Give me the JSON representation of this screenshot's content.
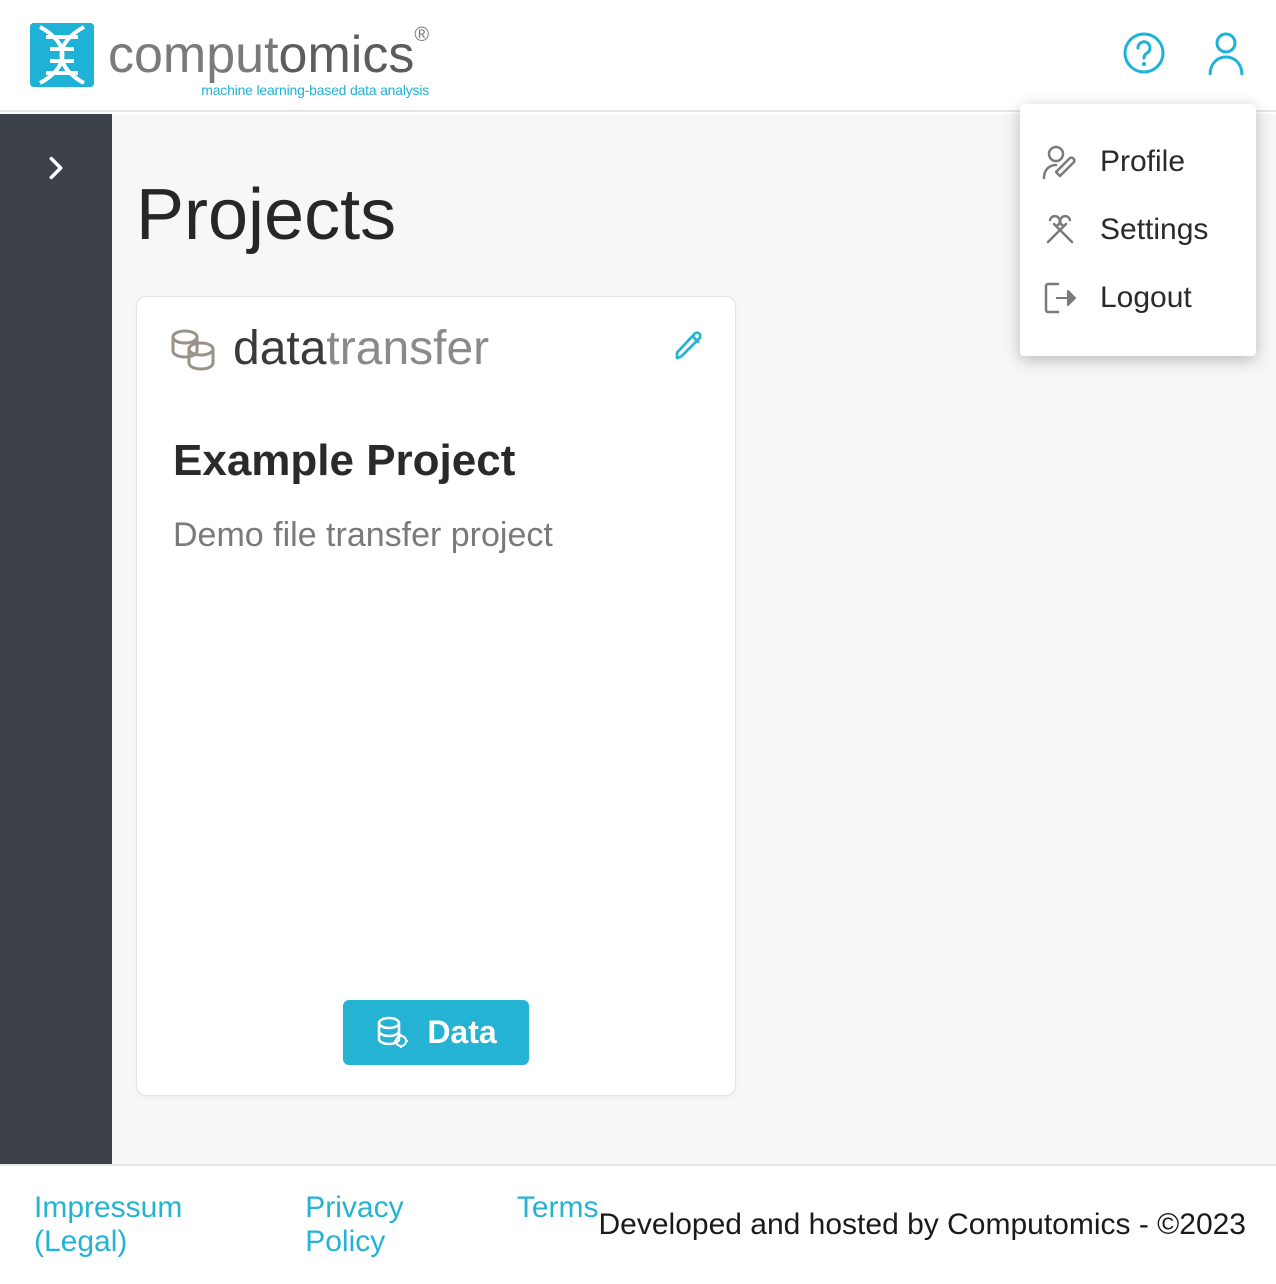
{
  "header": {
    "brand_part1": "comput",
    "brand_part2": "omics",
    "brand_reg": "®",
    "tagline": "machine learning-based data analysis"
  },
  "user_menu": {
    "profile": "Profile",
    "settings": "Settings",
    "logout": "Logout"
  },
  "page": {
    "title": "Projects"
  },
  "project": {
    "type_part1": "data",
    "type_part2": "transfer",
    "name": "Example Project",
    "description": "Demo file transfer project",
    "data_button": "Data"
  },
  "footer": {
    "legal": "Impressum (Legal)",
    "privacy": "Privacy Policy",
    "terms": "Terms",
    "credit": "Developed and hosted by Computomics - ©2023"
  }
}
